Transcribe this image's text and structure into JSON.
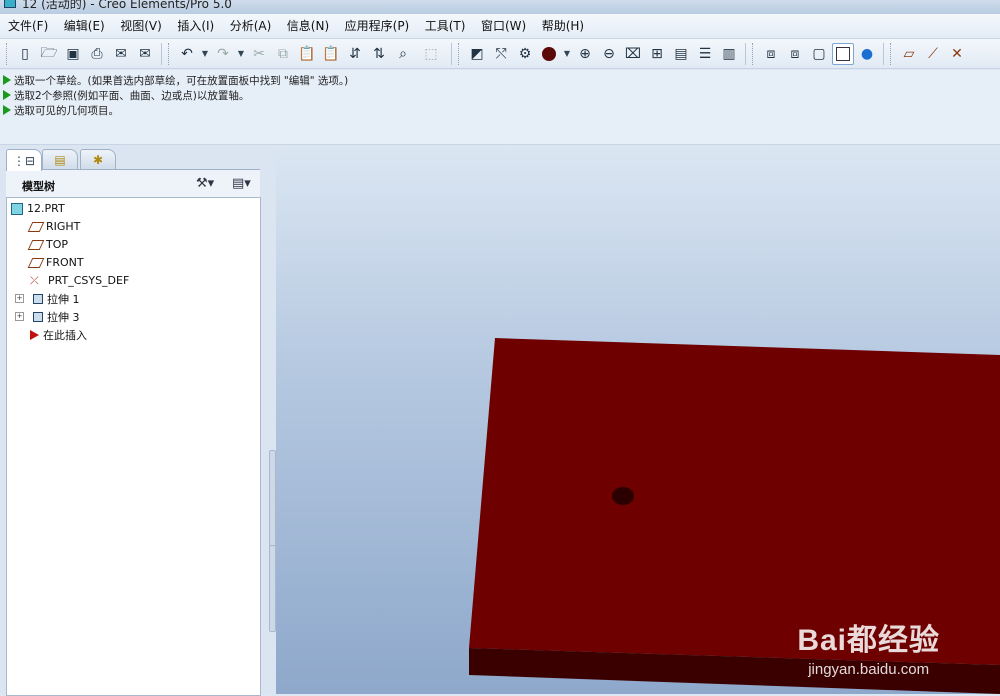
{
  "window": {
    "title": "12 (活动的) - Creo Elements/Pro 5.0"
  },
  "menu": [
    "文件(F)",
    "编辑(E)",
    "视图(V)",
    "插入(I)",
    "分析(A)",
    "信息(N)",
    "应用程序(P)",
    "工具(T)",
    "窗口(W)",
    "帮助(H)"
  ],
  "toolbar_icons": [
    "new-file-icon",
    "open-folder-icon",
    "save-icon",
    "print-icon",
    "email-icon",
    "email-link-icon",
    "undo-icon",
    "undo-dropdown-icon",
    "redo-icon",
    "redo-dropdown-icon",
    "cut-icon",
    "copy-icon",
    "paste-icon",
    "paste-special-icon",
    "regenerate-icon",
    "regenerate-manager-icon",
    "find-icon",
    "selection-filter-icon",
    "repaint-icon",
    "spin-center-icon",
    "orient-icon",
    "appearance-icon",
    "appearance-dropdown-icon",
    "zoom-in-icon",
    "zoom-out-icon",
    "refit-icon",
    "view-manager-icon",
    "saved-views-icon",
    "layers-icon",
    "annotation-icon",
    "wireframe-icon",
    "hidden-line-icon",
    "no-hidden-icon",
    "shading-icon",
    "enhanced-realism-icon",
    "plane-display-icon",
    "axis-display-icon",
    "point-display-icon"
  ],
  "messages": [
    "选取一个草绘。(如果首选内部草绘，可在放置面板中找到 \"编辑\" 选项。)",
    "选取2个参照(例如平面、曲面、边或点)以放置轴。",
    "选取可见的几何项目。"
  ],
  "navigator": {
    "tabs": [
      "model-tree-tab",
      "folder-browser-tab",
      "favorites-tab"
    ],
    "header_label": "模型树",
    "tree": [
      {
        "label": "12.PRT",
        "icon": "part-icon",
        "level": 0,
        "expandable": false
      },
      {
        "label": "RIGHT",
        "icon": "datum-plane-icon",
        "level": 1,
        "expandable": false
      },
      {
        "label": "TOP",
        "icon": "datum-plane-icon",
        "level": 1,
        "expandable": false
      },
      {
        "label": "FRONT",
        "icon": "datum-plane-icon",
        "level": 1,
        "expandable": false
      },
      {
        "label": "PRT_CSYS_DEF",
        "icon": "coordinate-system-icon",
        "level": 1,
        "expandable": false
      },
      {
        "label": "拉伸 1",
        "icon": "extrude-icon",
        "level": 1,
        "expandable": true
      },
      {
        "label": "拉伸 3",
        "icon": "extrude-icon",
        "level": 1,
        "expandable": true
      },
      {
        "label": "在此插入",
        "icon": "insert-here-icon",
        "level": 1,
        "expandable": false
      }
    ]
  },
  "colors": {
    "model_top": "#6e0000",
    "model_side": "#3a0000",
    "hole": "#2a0000",
    "background_top": "#dbe6f2",
    "background_bottom": "#8ea8cb"
  },
  "watermark": {
    "brand": "Bai都经验",
    "url": "jingyan.baidu.com"
  }
}
